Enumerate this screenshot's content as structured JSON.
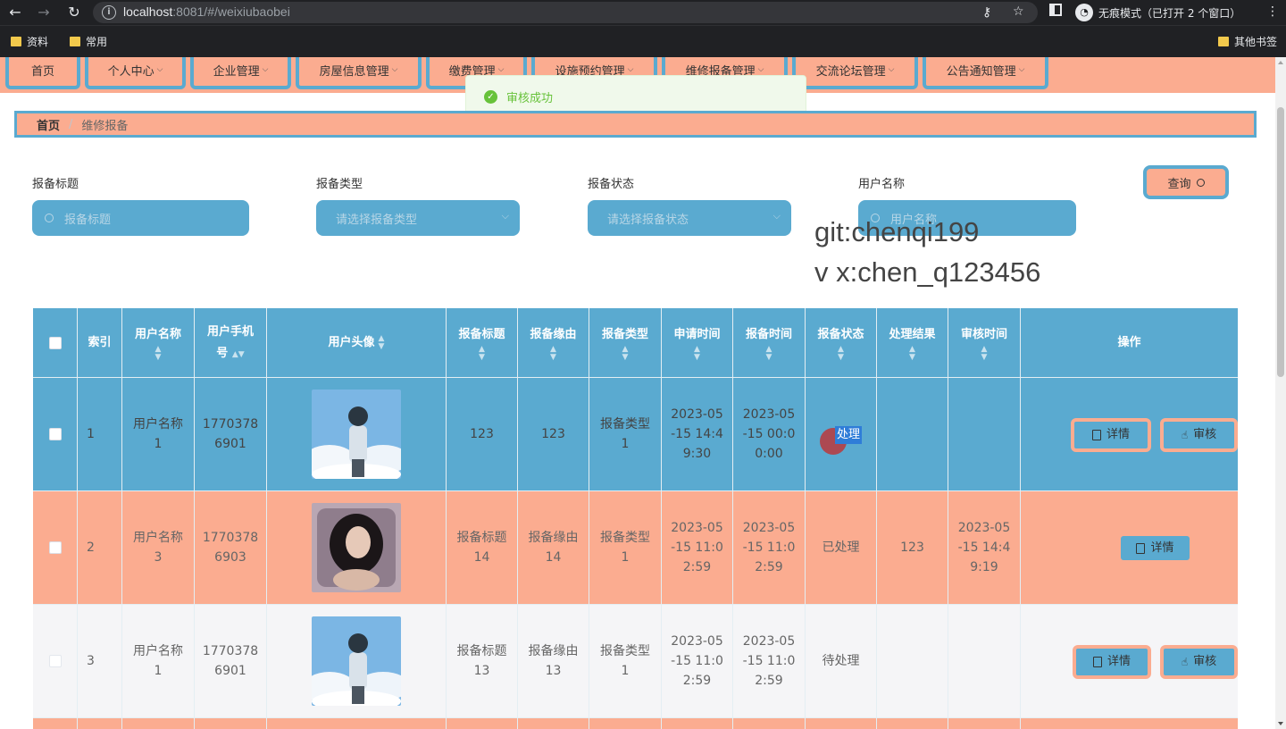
{
  "browser": {
    "url_host": "localhost",
    "url_rest": ":8081/#/weixiubaobei",
    "incognito_label": "无痕模式（已打开 2 个窗口）",
    "bookmarks": [
      "资料",
      "常用"
    ],
    "other_bookmarks": "其他书签"
  },
  "menu": [
    {
      "label": "首页",
      "dropdown": false
    },
    {
      "label": "个人中心",
      "dropdown": true
    },
    {
      "label": "企业管理",
      "dropdown": true
    },
    {
      "label": "房屋信息管理",
      "dropdown": true
    },
    {
      "label": "缴费管理",
      "dropdown": true
    },
    {
      "label": "设施预约管理",
      "dropdown": true
    },
    {
      "label": "维修报备管理",
      "dropdown": true
    },
    {
      "label": "交流论坛管理",
      "dropdown": true
    },
    {
      "label": "公告通知管理",
      "dropdown": true
    }
  ],
  "toast": {
    "message": "审核成功"
  },
  "breadcrumb": {
    "home": "首页",
    "current": "维修报备"
  },
  "search": {
    "title_label": "报备标题",
    "title_placeholder": "报备标题",
    "type_label": "报备类型",
    "type_placeholder": "请选择报备类型",
    "status_label": "报备状态",
    "status_placeholder": "请选择报备状态",
    "user_label": "用户名称",
    "user_placeholder": "用户名称",
    "query_button": "查询"
  },
  "watermark": {
    "line1": "git:chenqi199",
    "line2": "v x:chen_q123456"
  },
  "table": {
    "headers": {
      "index": "索引",
      "username": "用户名称",
      "phone": "用户手机号",
      "avatar": "用户头像",
      "title": "报备标题",
      "reason": "报备缘由",
      "type": "报备类型",
      "apply_time": "申请时间",
      "report_time": "报备时间",
      "status": "报备状态",
      "result": "处理结果",
      "review_time": "审核时间",
      "ops": "操作"
    },
    "rows": [
      {
        "index": "1",
        "username": "用户名称1",
        "phone": "17703786901",
        "title": "123",
        "reason": "123",
        "type": "报备类型1",
        "apply_time": "2023-05-15 14:49:30",
        "report_time": "2023-05-15 00:00:00",
        "status": "待处理",
        "status_selected": "处理",
        "result": "",
        "review_time": "",
        "detail": "详情",
        "review": "审核"
      },
      {
        "index": "2",
        "username": "用户名称3",
        "phone": "17703786903",
        "title": "报备标题14",
        "reason": "报备缘由14",
        "type": "报备类型1",
        "apply_time": "2023-05-15 11:02:59",
        "report_time": "2023-05-15 11:02:59",
        "status": "已处理",
        "result": "123",
        "review_time": "2023-05-15 14:49:19",
        "detail": "详情"
      },
      {
        "index": "3",
        "username": "用户名称1",
        "phone": "17703786901",
        "title": "报备标题13",
        "reason": "报备缘由13",
        "type": "报备类型1",
        "apply_time": "2023-05-15 11:02:59",
        "report_time": "2023-05-15 11:02:59",
        "status": "待处理",
        "result": "",
        "review_time": "",
        "detail": "详情",
        "review": "审核"
      }
    ]
  },
  "colors": {
    "primary_blue": "#5aaad0",
    "peach": "#fbac90",
    "success_green": "#67c23a"
  }
}
